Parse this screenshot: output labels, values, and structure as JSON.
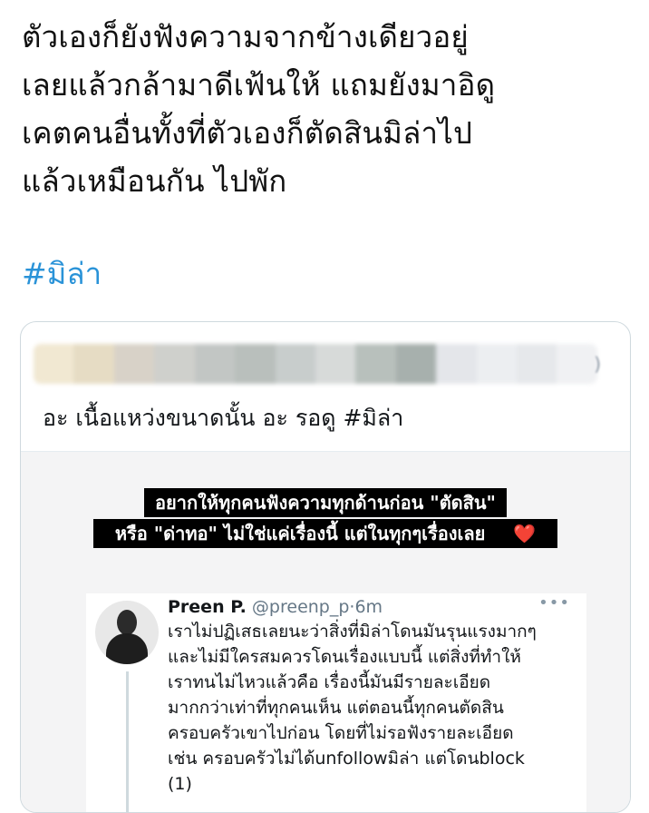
{
  "tweet": {
    "lines": [
      "ตัวเองก็ยังฟังความจากข้างเดียวอยู่",
      "เลยแล้วกล้ามาดีเฟ้นให้ แถมยังมาอิดู",
      "เคตคนอื่นทั้งที่ตัวเองก็ตัดสินมิล่าไป",
      "แล้วเหมือนกัน ไปพัก"
    ],
    "hashtag": "#มิล่า"
  },
  "quote": {
    "text": "อะ เนื้อแหว่งขนาดนั้น อะ รอดู  #มิล่า",
    "blur_colors": [
      "#f1e8d2",
      "#e6dcc4",
      "#d8d2c8",
      "#cfd0cc",
      "#c2c6c4",
      "#b9bfbc",
      "#c8cdcc",
      "#d7dad9",
      "#b8c0bc",
      "#a7b0ad",
      "#e4e6ea",
      "#eceef1",
      "#e6e8eb",
      "#f0f1f3"
    ],
    "edge_glyph": ")"
  },
  "media": {
    "caption_line1": "อยากให้ทุกคนฟังความทุกด้านก่อน \"ตัดสิน\"",
    "caption_line2": "หรือ \"ด่าทอ\" ไม่ใช่แค่เรื่องนี้ แต่ในทุกๆเรื่องเลย",
    "heart": "❤️",
    "inner_tweet": {
      "name": "Preen P.",
      "handle": "@preenp_p",
      "dot": "·",
      "time": "6m",
      "more": "•••",
      "lines": [
        "เราไม่ปฏิเสธเลยนะว่าสิ่งที่มิล่าโดนมันรุนแรงมากๆ",
        "และไม่มีใครสมควรโดนเรื่องแบบนี้ แต่สิ่งที่ทำให้",
        "เราทนไม่ไหวแล้วคือ เรื่องนี้มันมีรายละเอียด",
        "มากกว่าเท่าที่ทุกคนเห็น แต่ตอนนี้ทุกคนตัดสิน",
        "ครอบครัวเขาไปก่อน โดยที่ไม่รอฟังรายละเอียด",
        "เช่น ครอบครัวไม่ได้unfollowมิล่า แต่โดนblock",
        "(1)"
      ]
    }
  }
}
